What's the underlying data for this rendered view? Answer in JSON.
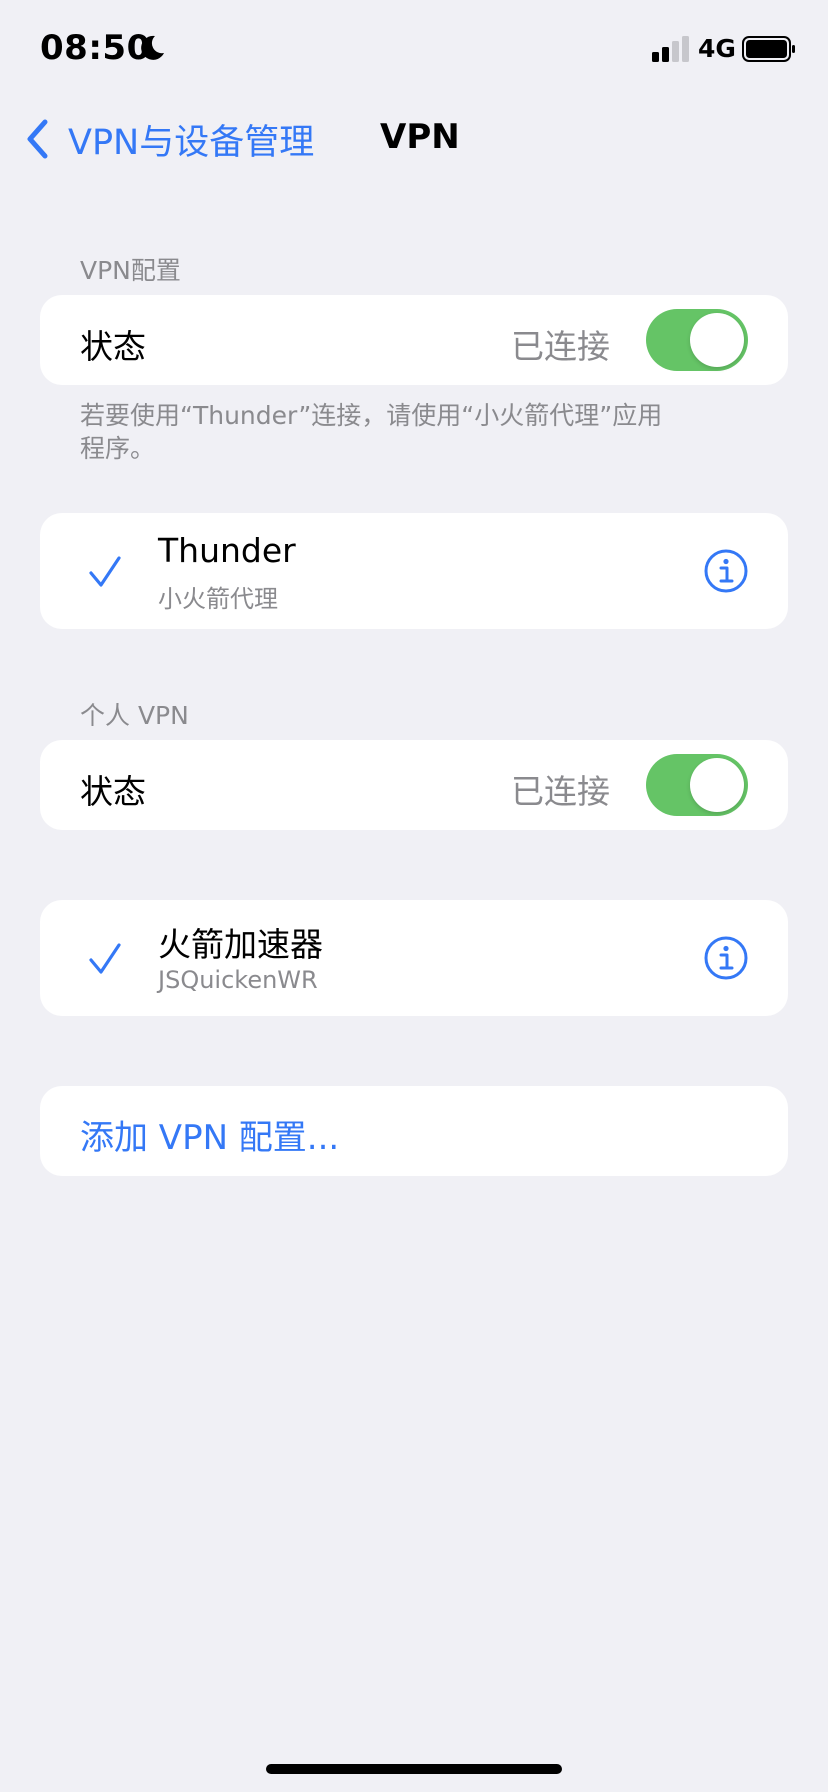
{
  "status_bar": {
    "time": "08:50",
    "network": "4G"
  },
  "nav": {
    "back_label": "VPN与设备管理",
    "title": "VPN"
  },
  "vpn_config": {
    "header": "VPN配置",
    "status_label": "状态",
    "status_value": "已连接",
    "toggle_on": true,
    "note": "若要使用“Thunder”连接，请使用“小火箭代理”应用程序。",
    "item": {
      "title": "Thunder",
      "subtitle": "小火箭代理",
      "selected": true
    }
  },
  "personal_vpn": {
    "header": "个人 VPN",
    "status_label": "状态",
    "status_value": "已连接",
    "toggle_on": true,
    "item": {
      "title": "火箭加速器",
      "subtitle": "JSQuickenWR",
      "selected": true
    }
  },
  "add_config_label": "添加 VPN 配置...",
  "colors": {
    "accent": "#3478f6",
    "toggle_on": "#65c466",
    "background": "#f0f0f5",
    "secondary_text": "#8a8a8e"
  }
}
